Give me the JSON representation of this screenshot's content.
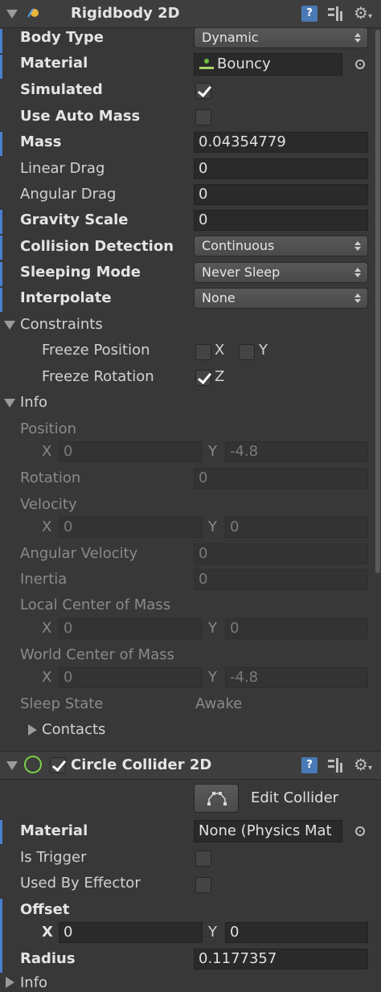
{
  "rigidbody": {
    "title": "Rigidbody 2D",
    "body_type_label": "Body Type",
    "body_type_value": "Dynamic",
    "material_label": "Material",
    "material_value": "Bouncy",
    "simulated_label": "Simulated",
    "use_auto_mass_label": "Use Auto Mass",
    "mass_label": "Mass",
    "mass_value": "0.04354779",
    "linear_drag_label": "Linear Drag",
    "linear_drag_value": "0",
    "angular_drag_label": "Angular Drag",
    "angular_drag_value": "0",
    "gravity_scale_label": "Gravity Scale",
    "gravity_scale_value": "0",
    "collision_detection_label": "Collision Detection",
    "collision_detection_value": "Continuous",
    "sleeping_mode_label": "Sleeping Mode",
    "sleeping_mode_value": "Never Sleep",
    "interpolate_label": "Interpolate",
    "interpolate_value": "None",
    "constraints_label": "Constraints",
    "freeze_position_label": "Freeze Position",
    "freeze_rotation_label": "Freeze Rotation",
    "x_label": "X",
    "y_label": "Y",
    "z_label": "Z"
  },
  "info": {
    "label": "Info",
    "position_label": "Position",
    "position_x": "0",
    "position_y": "-4.8",
    "rotation_label": "Rotation",
    "rotation_value": "0",
    "velocity_label": "Velocity",
    "velocity_x": "0",
    "velocity_y": "0",
    "angular_velocity_label": "Angular Velocity",
    "angular_velocity_value": "0",
    "inertia_label": "Inertia",
    "inertia_value": "0",
    "local_com_label": "Local Center of Mass",
    "local_com_x": "0",
    "local_com_y": "0",
    "world_com_label": "World Center of Mass",
    "world_com_x": "0",
    "world_com_y": "-4.8",
    "sleep_state_label": "Sleep State",
    "sleep_state_value": "Awake",
    "contacts_label": "Contacts",
    "x": "X",
    "y": "Y"
  },
  "collider": {
    "title": "Circle Collider 2D",
    "edit_collider_label": "Edit Collider",
    "material_label": "Material",
    "material_value": "None (Physics Mat",
    "is_trigger_label": "Is Trigger",
    "used_by_effector_label": "Used By Effector",
    "offset_label": "Offset",
    "offset_x": "0",
    "offset_y": "0",
    "radius_label": "Radius",
    "radius_value": "0.1177357",
    "next_label": "Info",
    "x": "X",
    "y": "Y"
  },
  "colors": {
    "background": "#383838",
    "modified_marker": "#4a7fd0",
    "field_bg": "#2a2a2a"
  }
}
